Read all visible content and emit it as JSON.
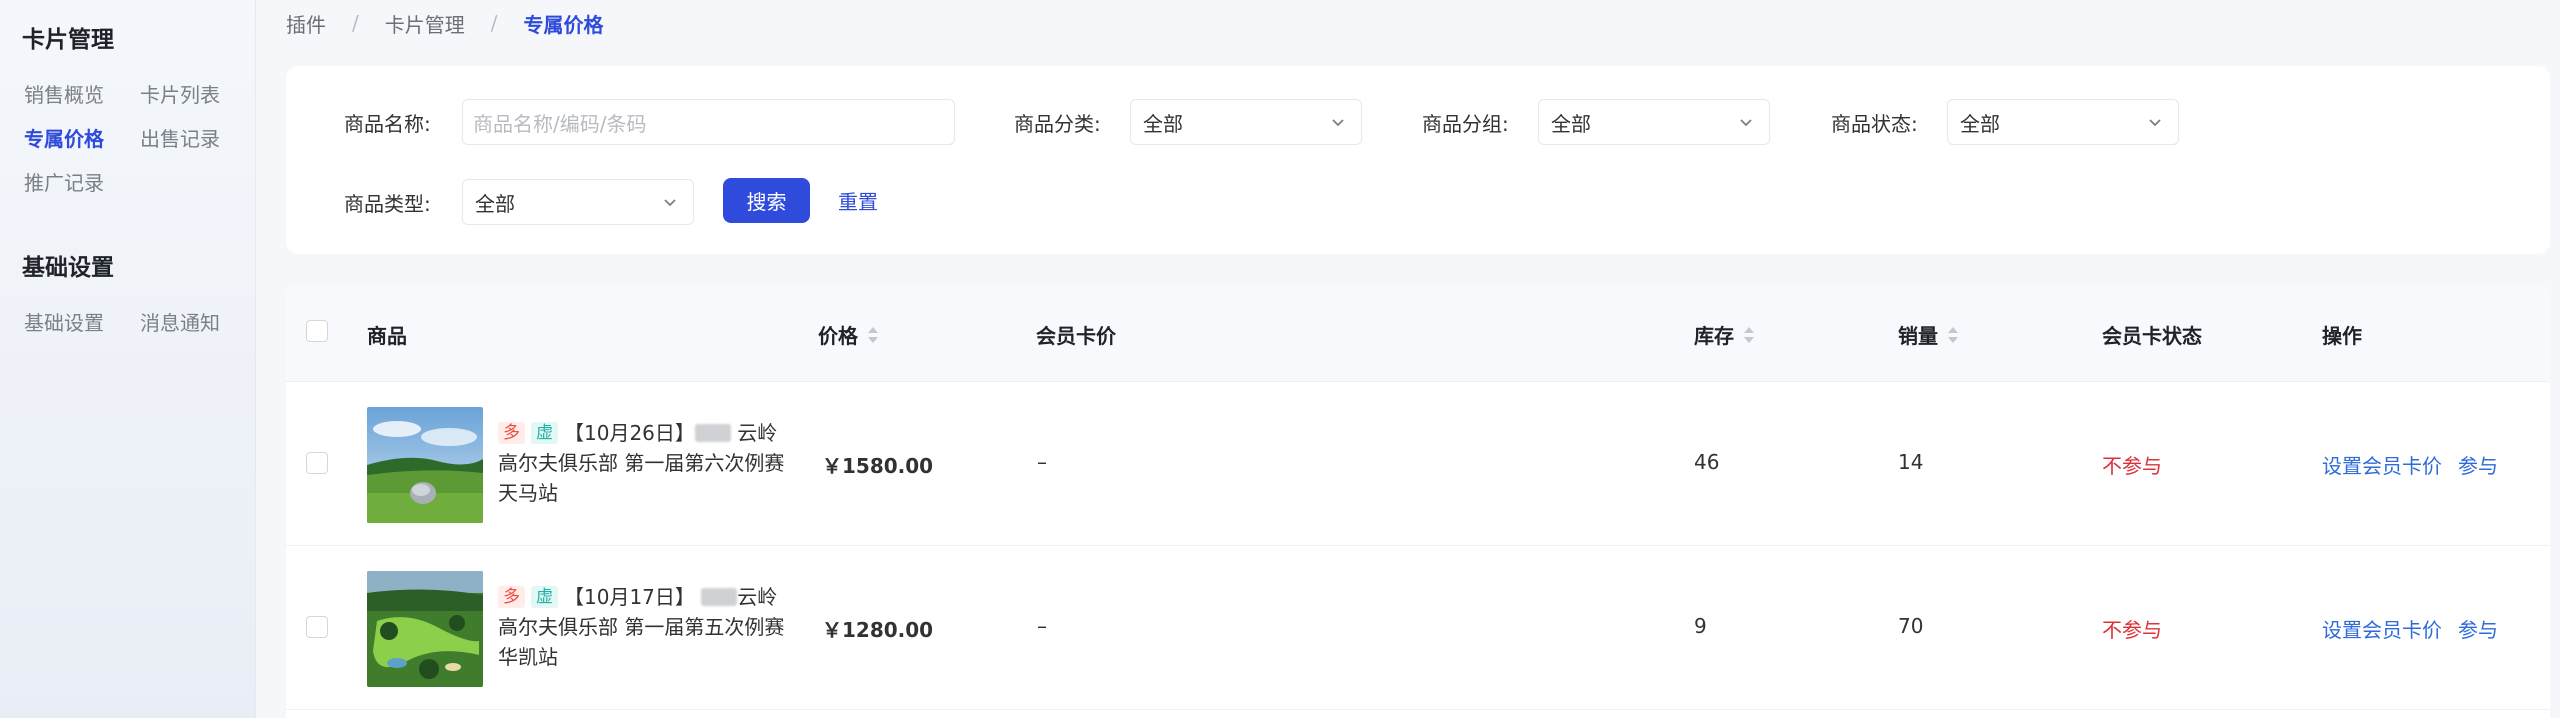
{
  "sidebar": {
    "section1_title": "卡片管理",
    "items1": [
      {
        "label": "销售概览"
      },
      {
        "label": "卡片列表"
      },
      {
        "label": "专属价格"
      },
      {
        "label": "出售记录"
      },
      {
        "label": "推广记录"
      }
    ],
    "section2_title": "基础设置",
    "items2": [
      {
        "label": "基础设置"
      },
      {
        "label": "消息通知"
      }
    ]
  },
  "breadcrumb": {
    "items": [
      "插件",
      "卡片管理",
      "专属价格"
    ],
    "separator": "/"
  },
  "filters": {
    "name_label": "商品名称:",
    "name_placeholder": "商品名称/编码/条码",
    "category_label": "商品分类:",
    "category_value": "全部",
    "group_label": "商品分组:",
    "group_value": "全部",
    "status_label": "商品状态:",
    "status_value": "全部",
    "type_label": "商品类型:",
    "type_value": "全部",
    "search_button": "搜索",
    "reset_button": "重置"
  },
  "table": {
    "headers": {
      "product": "商品",
      "price": "价格",
      "member_price": "会员卡价",
      "stock": "库存",
      "sales": "销量",
      "member_status": "会员卡状态",
      "actions": "操作"
    },
    "rows": [
      {
        "tag1": "多",
        "tag2": "虚",
        "name_prefix": "【10月26日】",
        "name_rest": "云岭高尔夫俱乐部 第一届第六次例赛 天马站",
        "price": "￥1580.00",
        "member_price": "–",
        "stock": "46",
        "sales": "14",
        "member_status": "不参与",
        "action_set": "设置会员卡价",
        "action_join": "参与"
      },
      {
        "tag1": "多",
        "tag2": "虚",
        "name_prefix": "【10月17日】",
        "name_rest": "云岭高尔夫俱乐部 第一届第五次例赛 华凯站",
        "price": "￥1280.00",
        "member_price": "–",
        "stock": "9",
        "sales": "70",
        "member_status": "不参与",
        "action_set": "设置会员卡价",
        "action_join": "参与"
      }
    ]
  },
  "colors": {
    "accent": "#2f4bdb",
    "link": "#2f6bdb",
    "danger": "#e0303a",
    "tag_duo": "#ee4d3b",
    "tag_xu": "#20b2a8"
  }
}
